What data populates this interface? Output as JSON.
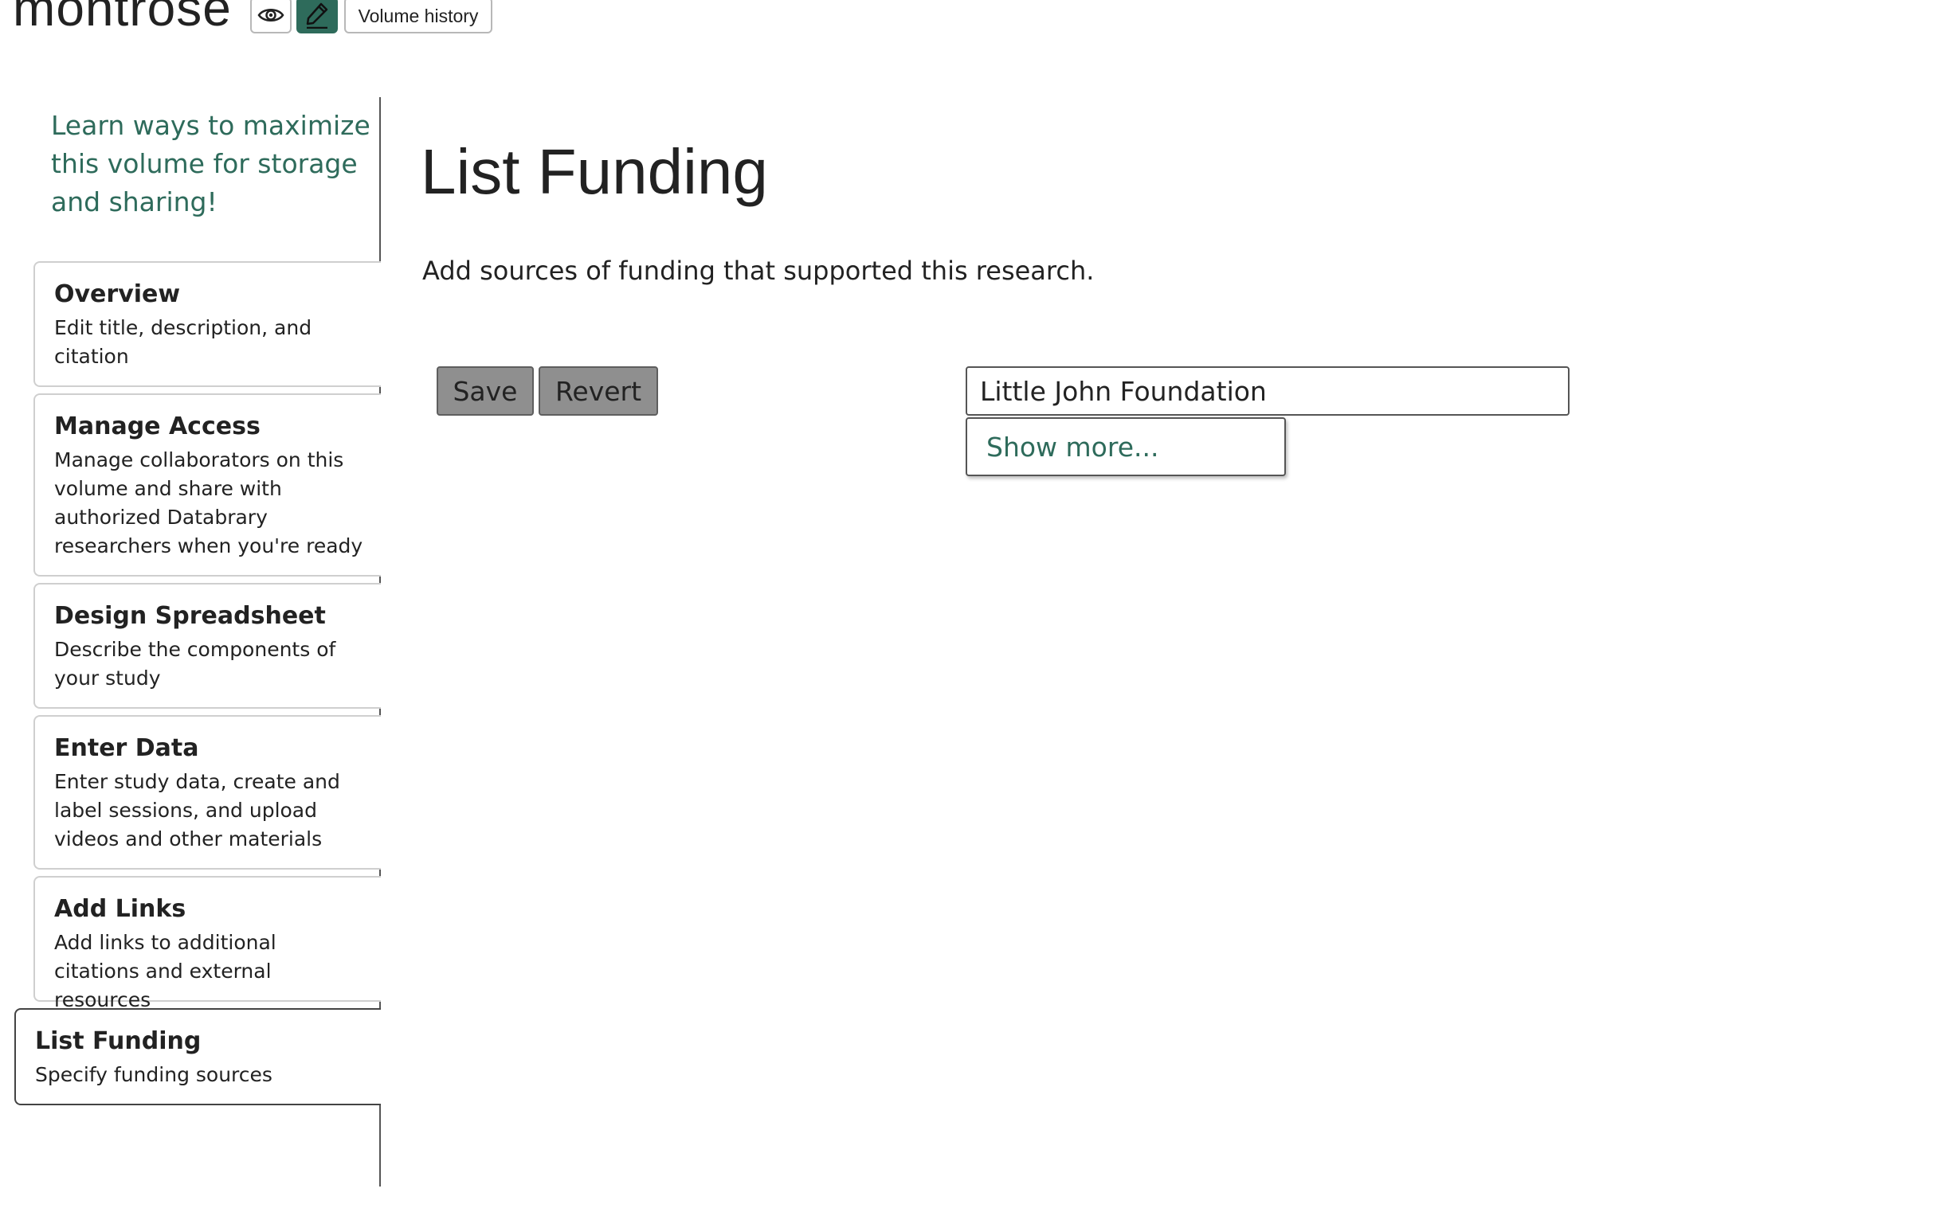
{
  "header": {
    "brand": "montrose",
    "view_icon": "eye-icon",
    "edit_icon": "pencil-icon",
    "history_label": "Volume history"
  },
  "sidebar": {
    "tip": "Learn ways to maximize this volume for storage and sharing!",
    "items": [
      {
        "title": "Overview",
        "desc": "Edit title, description, and citation"
      },
      {
        "title": "Manage Access",
        "desc": "Manage collaborators on this volume and share with authorized Databrary researchers when you're ready"
      },
      {
        "title": "Design Spreadsheet",
        "desc": "Describe the components of your study"
      },
      {
        "title": "Enter Data",
        "desc": "Enter study data, create and label sessions, and upload videos and other materials"
      },
      {
        "title": "Add Links",
        "desc": "Add links to additional citations and external resources"
      },
      {
        "title": "List Funding",
        "desc": "Specify funding sources",
        "active": true
      }
    ]
  },
  "main": {
    "title": "List Funding",
    "description": "Add sources of funding that supported this research.",
    "save_label": "Save",
    "revert_label": "Revert",
    "funder_value": "Little John Foundation",
    "show_more_label": "Show more..."
  },
  "colors": {
    "accent": "#2e6b5b",
    "button_gray": "#8f8f8f",
    "text": "#222222"
  }
}
